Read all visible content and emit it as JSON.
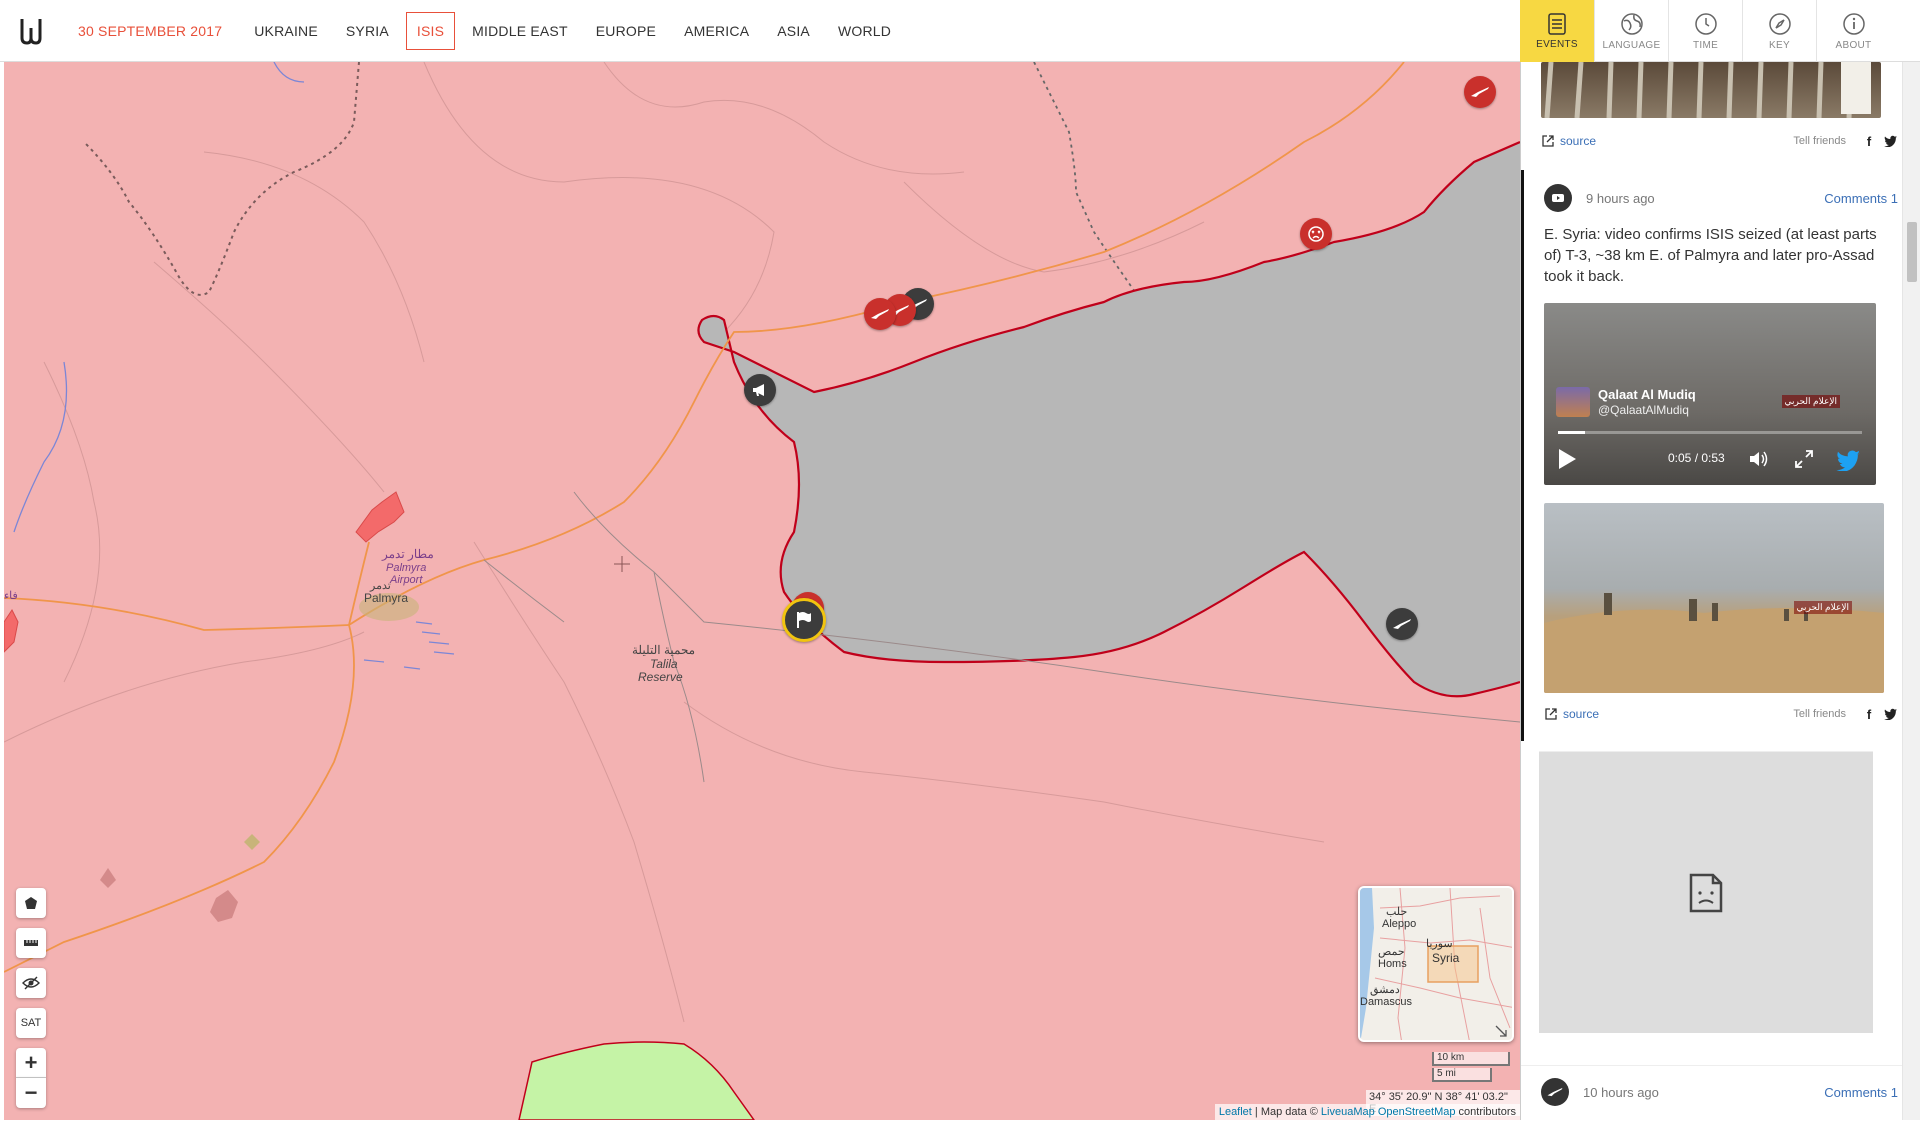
{
  "header": {
    "date": "30 SEPTEMBER 2017",
    "nav": [
      "UKRAINE",
      "SYRIA",
      "ISIS",
      "MIDDLE EAST",
      "EUROPE",
      "AMERICA",
      "ASIA",
      "WORLD"
    ],
    "active_nav": "ISIS"
  },
  "toolbar": {
    "events": "EVENTS",
    "language": "LANGUAGE",
    "time": "TIME",
    "key": "KEY",
    "about": "ABOUT"
  },
  "map": {
    "labels": {
      "airport_ar": "مطار تدمر",
      "airport_en1": "Palmyra",
      "airport_en2": "Airport",
      "palmyra_ar": "تدمر",
      "palmyra_en": "Palmyra",
      "reserve_ar": "محمية التليلة",
      "reserve_en1": "Talila",
      "reserve_en2": "Reserve",
      "edge_ar": "فاء"
    },
    "controls": {
      "satellite": "SAT",
      "zoom_in": "+",
      "zoom_out": "−"
    },
    "minimap": {
      "aleppo_ar": "حلب",
      "aleppo": "Aleppo",
      "homs_ar": "حمص",
      "homs": "Homs",
      "damascus_ar": "دمشق",
      "damascus": "Damascus",
      "syria_ar": "سوريا",
      "syria": "Syria"
    },
    "scale": {
      "km": "10 km",
      "mi": "5 mi"
    },
    "coords": "34° 35' 20.9\" N 38° 41' 03.2\" E",
    "attribution": {
      "leaflet": "Leaflet",
      "sep": " | Map data © ",
      "livemap": "LiveuaMap",
      "osm": "OpenStreetMap",
      "contributors": " contributors"
    },
    "colors": {
      "isis": "#f3b2b2",
      "contested": "#b7b7b7",
      "green": "#c5f3a6",
      "border": "#c0001a",
      "road": "#f0954a"
    }
  },
  "panel": {
    "top_event": {
      "source": "source",
      "tell": "Tell friends"
    },
    "event1": {
      "time": "9 hours ago",
      "comments": "Comments 1",
      "text": "E. Syria: video confirms ISIS seized (at least parts of) T-3, ~38 km E. of Palmyra and later pro-Assad took it back.",
      "video": {
        "channel": "Qalaat Al Mudiq",
        "handle": "@QalaatAlMudiq",
        "time": "0:05 / 0:53",
        "watermark": "الإعلام الحربي"
      },
      "photo_watermark": "الإعلام الحربي",
      "source": "source",
      "tell": "Tell friends"
    },
    "event2": {
      "time": "10 hours ago",
      "comments": "Comments 1"
    }
  }
}
